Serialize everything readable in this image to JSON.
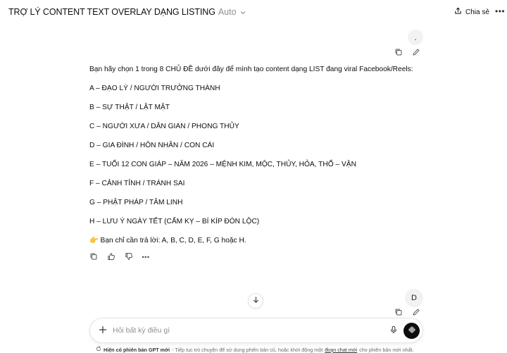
{
  "header": {
    "title": "TRỢ LÝ CONTENT TEXT OVERLAY DẠNG LISTING",
    "model": "Auto",
    "share_label": "Chia sẻ",
    "more_label": "•••"
  },
  "first_user_message": {
    "text": "."
  },
  "assistant_message": {
    "intro": "Bạn hãy chọn 1 trong 8 CHỦ ĐỀ dưới đây để mình tạo content dạng LIST đang viral Facebook/Reels:",
    "options": [
      "A – ĐẠO LÝ / NGƯỜI TRƯỞNG THÀNH",
      "B – SỰ THẬT / LẬT MẶT",
      "C – NGƯỜI XƯA / DÂN GIAN / PHONG THỦY",
      "D – GIA ĐÌNH / HÔN NHÂN / CON CÁI",
      "E – TUỔI 12 CON GIÁP – NĂM 2026 – MỆNH KIM, MỘC, THỦY, HỎA, THỔ – VẬN",
      "F – CẢNH TỈNH / TRÁNH SAI",
      "G – PHẬT PHÁP / TÂM LINH",
      "H – LƯU Ý NGÀY TẾT (CẤM KỴ – BÍ KÍP ĐÓN LỘC)"
    ],
    "closing_emoji": "👉",
    "closing": "Bạn chỉ cần trả lời: A, B, C, D, E, F, G hoặc H.",
    "more_label": "•••"
  },
  "second_user_message": {
    "text": "D"
  },
  "composer": {
    "placeholder": "Hỏi bất kỳ điều gì"
  },
  "footer": {
    "bold": "Hiện có phiên bản GPT mới",
    "text": "- Tiếp tục trò chuyện để sử dụng phiên bản cũ, hoặc khởi động một",
    "link": "đoạn chat mới",
    "tail": "cho phiên bản mới nhất."
  },
  "colors": {
    "text": "#0d0d0d",
    "muted": "#8f8f8f",
    "bubble": "#f2f2f2",
    "send": "#0d0d0d"
  }
}
